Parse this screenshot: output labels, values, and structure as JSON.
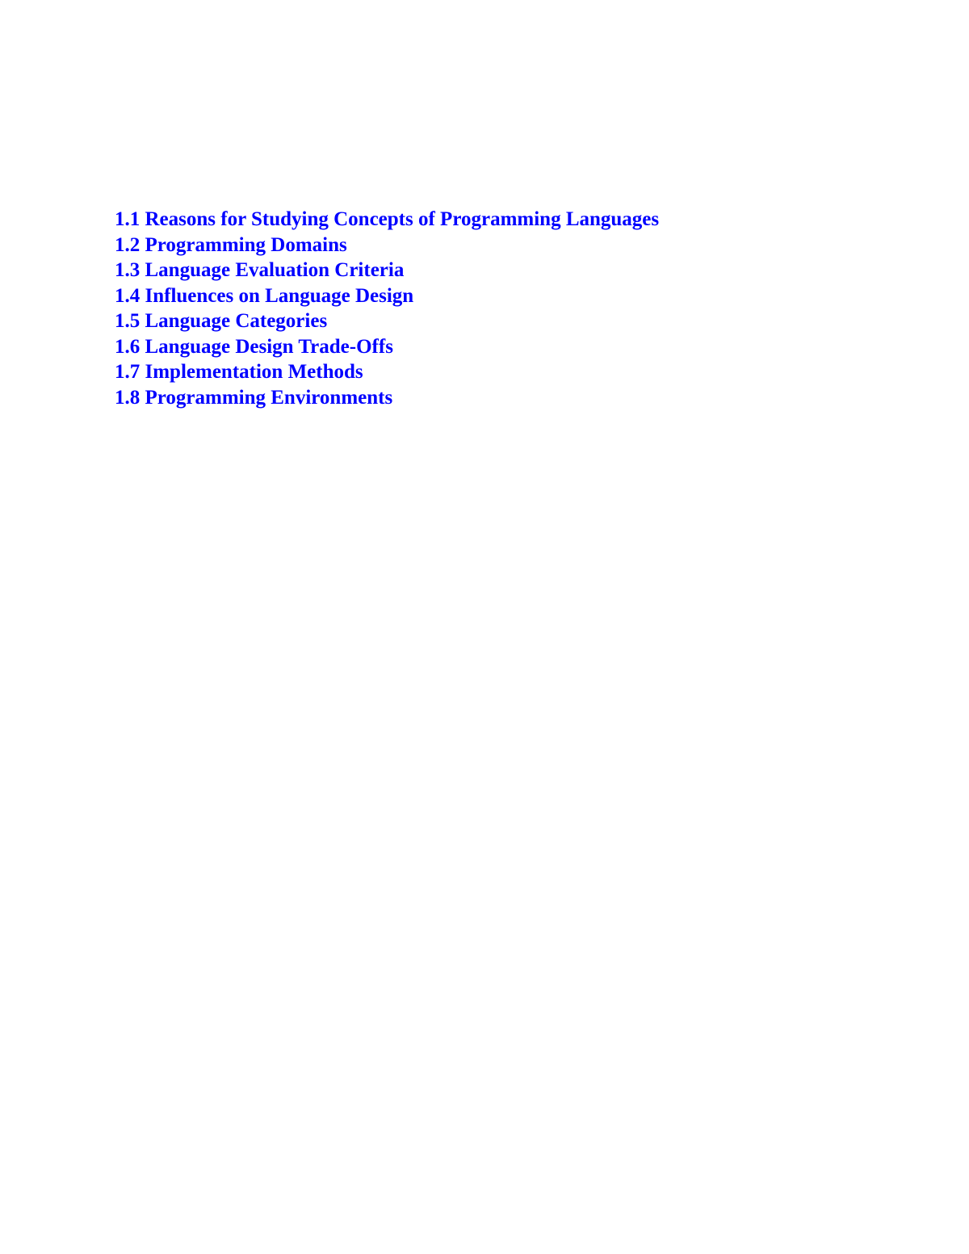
{
  "toc": {
    "link_color": "#0000ff",
    "items": [
      {
        "label": "1.1 Reasons for Studying Concepts of Programming Languages"
      },
      {
        "label": "1.2 Programming Domains"
      },
      {
        "label": "1.3 Language Evaluation Criteria"
      },
      {
        "label": "1.4 Influences on Language Design"
      },
      {
        "label": "1.5 Language Categories"
      },
      {
        "label": "1.6 Language Design Trade-Offs"
      },
      {
        "label": "1.7 Implementation Methods"
      },
      {
        "label": "1.8 Programming Environments"
      }
    ]
  }
}
